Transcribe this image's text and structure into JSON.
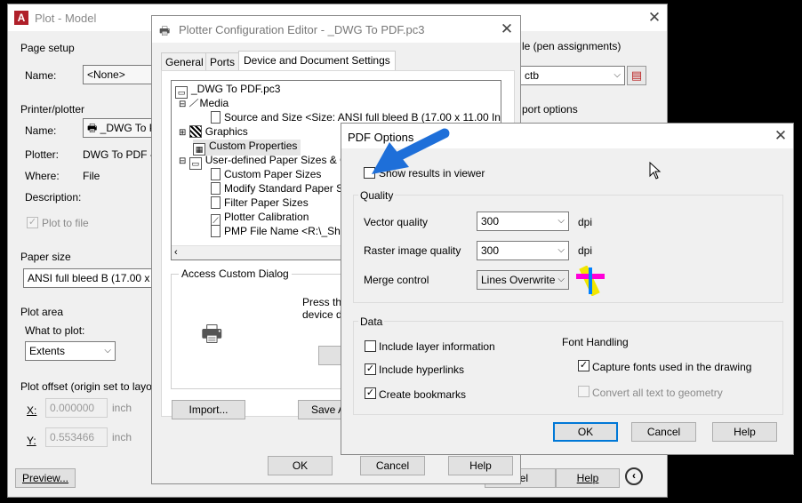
{
  "plot": {
    "title": "Plot - Model",
    "page_setup": {
      "heading": "Page setup",
      "name_label": "Name:",
      "name_value": "<None>"
    },
    "plot_style": {
      "heading": "le (pen assignments)",
      "value": "ctb"
    },
    "viewport": {
      "heading": "port options"
    },
    "printer": {
      "heading": "Printer/plotter",
      "name_label": "Name:",
      "name_value": "_DWG To P",
      "plotter_label": "Plotter:",
      "plotter_value": "DWG To PDF - P",
      "where_label": "Where:",
      "where_value": "File",
      "description_label": "Description:",
      "plot_to_file_label": "Plot to file"
    },
    "paper": {
      "heading": "Paper size",
      "value": "ANSI full bleed B (17.00 x 11"
    },
    "area": {
      "heading": "Plot area",
      "what_label": "What to plot:",
      "what_value": "Extents"
    },
    "offset": {
      "heading": "Plot offset (origin set to layout",
      "x_label": "X:",
      "x_value": "0.000000",
      "x_unit": "inch",
      "y_label": "Y:",
      "y_value": "0.553466",
      "y_unit": "inch"
    },
    "preview_button": "Preview...",
    "cancel_button": "el",
    "help_button": "Help"
  },
  "pce": {
    "title": "Plotter Configuration Editor - _DWG To PDF.pc3",
    "tabs": [
      "General",
      "Ports",
      "Device and Document Settings"
    ],
    "tree": {
      "root": "_DWG To PDF.pc3",
      "media": "Media",
      "source": "Source and Size <Size: ANSI full bleed B (17.00 x 11.00 Inches)",
      "graphics": "Graphics",
      "custom_props": "Custom Properties",
      "user_defined": "User-defined Paper Sizes & Cal",
      "custom_paper": "Custom Paper Sizes",
      "modify_standard": "Modify Standard Paper Size",
      "filter_paper": "Filter Paper Sizes",
      "calibration": "Plotter Calibration",
      "pmp": "PMP File Name <R:\\_Share"
    },
    "access_heading": "Access Custom Dialog",
    "press_text_1": "Press the",
    "press_text_2": "device dr",
    "import_button": "Import...",
    "save_button": "Save A",
    "ok_button": "OK",
    "cancel_button": "Cancel",
    "help_button": "Help"
  },
  "pdf": {
    "title": "PDF Options",
    "show_results_label": "Show results in viewer",
    "show_results_checked": false,
    "quality_heading": "Quality",
    "vector_label": "Vector quality",
    "vector_value": "300",
    "vector_unit": "dpi",
    "raster_label": "Raster image quality",
    "raster_value": "300",
    "raster_unit": "dpi",
    "merge_label": "Merge control",
    "merge_value": "Lines Overwrite",
    "data_heading": "Data",
    "include_layer_label": "Include layer information",
    "include_layer_checked": false,
    "include_hyperlinks_label": "Include hyperlinks",
    "include_hyperlinks_checked": true,
    "create_bookmarks_label": "Create bookmarks",
    "create_bookmarks_checked": true,
    "font_heading": "Font Handling",
    "capture_fonts_label": "Capture fonts used in the drawing",
    "capture_fonts_checked": true,
    "convert_text_label": "Convert all text to geometry",
    "convert_text_checked": false,
    "ok_button": "OK",
    "cancel_button": "Cancel",
    "help_button": "Help"
  },
  "colors": {
    "accent": "#0078d7",
    "arrow": "#1e6fd9",
    "window_bg": "#f0f0f0"
  }
}
